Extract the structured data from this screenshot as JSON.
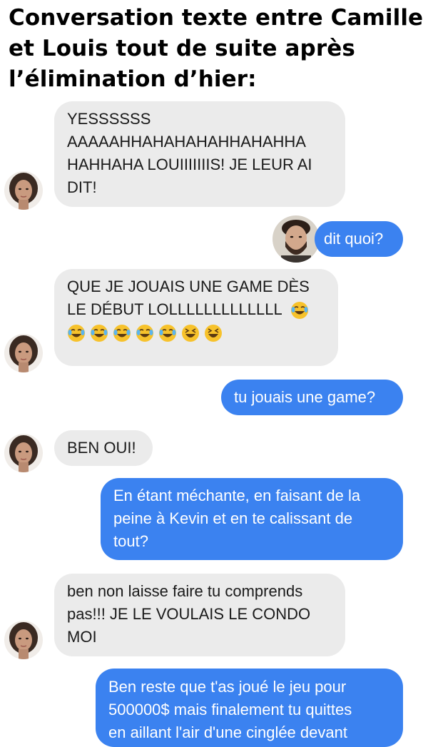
{
  "title": "Conversation texte entre Camille et Louis tout de suite après l’élimination d’hier:",
  "colors": {
    "sent_bubble": "#3b82f0",
    "received_bubble": "#ebebeb",
    "background": "#ffffff"
  },
  "messages": [
    {
      "sender": "Camille",
      "text": "YESSSSSS\nAAAAAHHAHAHAHAHHAHAHHA\nHAHHAHA LOUIIIIIIIS! JE LEUR AI\nDIT!"
    },
    {
      "sender": "Louis",
      "text": "dit quoi?"
    },
    {
      "sender": "Camille",
      "text": "QUE JE JOUAIS UNE GAME DÈS\nLE DÉBUT LOLLLLLLLLLLLLL",
      "emojis": [
        "face-with-tears-of-joy-icon",
        "face-with-tears-of-joy-icon",
        "face-with-tears-of-joy-icon",
        "face-with-tears-of-joy-icon",
        "face-with-tears-of-joy-icon",
        "face-with-tears-of-joy-icon",
        "laughing-face-icon",
        "laughing-face-icon"
      ]
    },
    {
      "sender": "Louis",
      "text": "tu jouais une game?"
    },
    {
      "sender": "Camille",
      "text": "BEN OUI!"
    },
    {
      "sender": "Louis",
      "text": "En étant méchante, en faisant de la\npeine à Kevin et en te calissant de\ntout?"
    },
    {
      "sender": "Camille",
      "text": "ben non laisse faire tu comprends\npas!!!  JE LE VOULAIS LE CONDO\nMOI"
    },
    {
      "sender": "Louis",
      "text": "Ben reste que t'as joué le jeu pour\n500000$ mais finalement tu quittes\nen aillant l'air d'une cinglée devant"
    }
  ]
}
